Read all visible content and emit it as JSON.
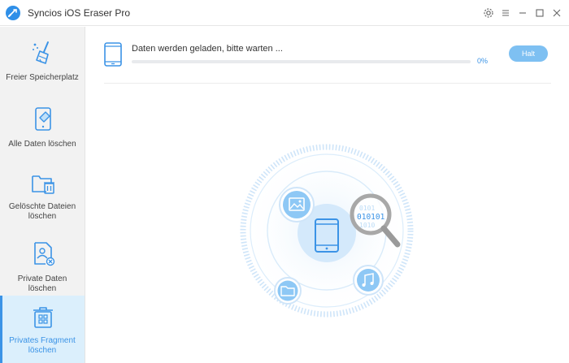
{
  "window": {
    "title": "Syncios iOS Eraser Pro"
  },
  "sidebar": {
    "items": [
      {
        "label": "Freier Speicherplatz",
        "icon": "broom-icon",
        "active": false
      },
      {
        "label": "Alle Daten löschen",
        "icon": "phone-eraser-icon",
        "active": false
      },
      {
        "label": "Gelöschte Dateien löschen",
        "icon": "folder-trash-icon",
        "active": false
      },
      {
        "label": "Private Daten löschen",
        "icon": "private-file-icon",
        "active": false
      },
      {
        "label": "Privates Fragment löschen",
        "icon": "fragment-trash-icon",
        "active": true
      }
    ]
  },
  "status": {
    "message": "Daten werden geladen, bitte warten ...",
    "percent_text": "0%",
    "progress": 0.0
  },
  "actions": {
    "halt_label": "Halt"
  },
  "scan_art": {
    "binary_text": "010101",
    "icons": [
      "image-icon",
      "phone-icon",
      "music-icon",
      "folder-icon",
      "magnifier-icon"
    ]
  },
  "colors": {
    "accent": "#3b93e6",
    "button": "#7ec0f2",
    "sidebar_bg": "#f2f2f2",
    "sidebar_active": "#dbeffc"
  }
}
